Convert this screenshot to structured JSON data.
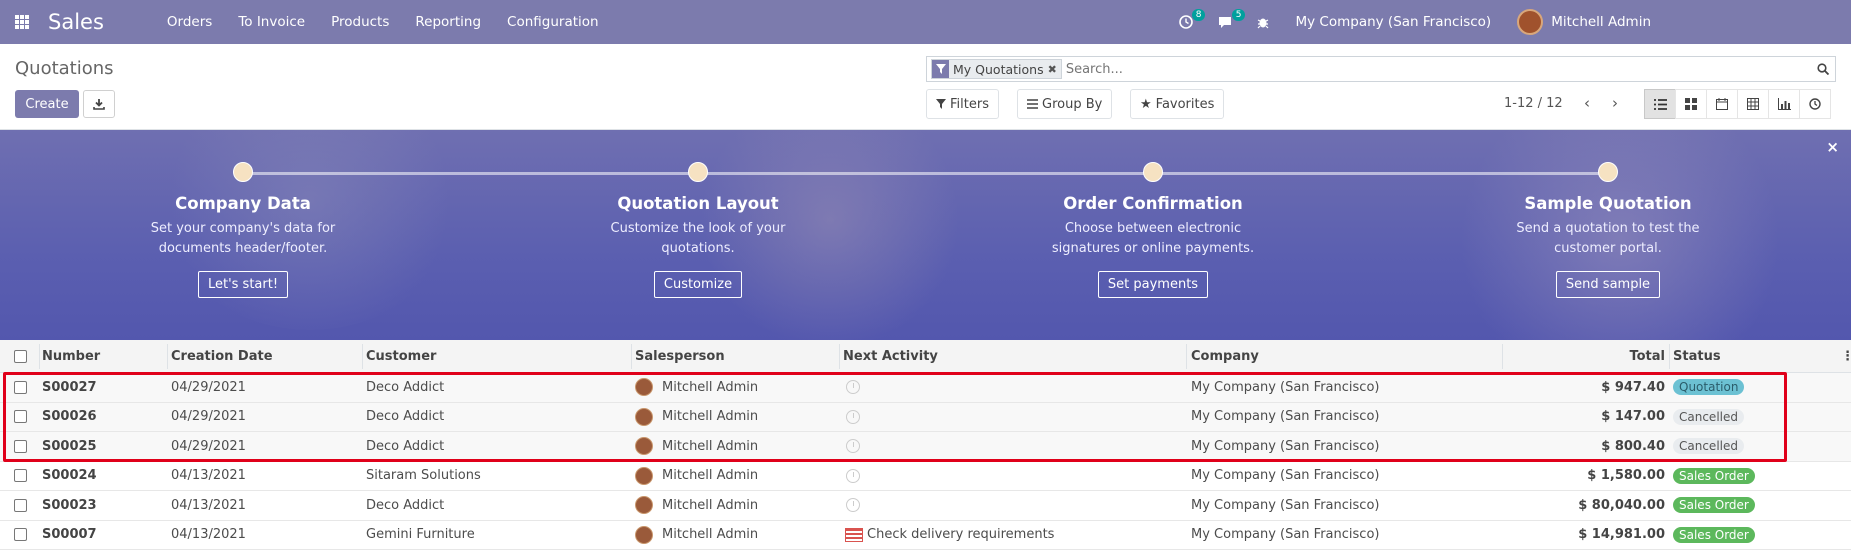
{
  "navbar": {
    "app_title": "Sales",
    "menu": [
      "Orders",
      "To Invoice",
      "Products",
      "Reporting",
      "Configuration"
    ],
    "activity_count": "8",
    "messages_count": "5",
    "company": "My Company (San Francisco)",
    "user": "Mitchell Admin"
  },
  "control_panel": {
    "breadcrumb": "Quotations",
    "create_label": "Create",
    "facet_label": "My Quotations",
    "search_placeholder": "Search...",
    "filters_label": "Filters",
    "groupby_label": "Group By",
    "favorites_label": "Favorites",
    "pager": "1-12 / 12"
  },
  "onboarding": {
    "steps": [
      {
        "title": "Company Data",
        "desc": "Set your company's data for documents header/footer.",
        "button": "Let's start!"
      },
      {
        "title": "Quotation Layout",
        "desc": "Customize the look of your quotations.",
        "button": "Customize"
      },
      {
        "title": "Order Confirmation",
        "desc": "Choose between electronic signatures or online payments.",
        "button": "Set payments"
      },
      {
        "title": "Sample Quotation",
        "desc": "Send a quotation to test the customer portal.",
        "button": "Send sample"
      }
    ],
    "close_icon": "×"
  },
  "table": {
    "headers": {
      "number": "Number",
      "creation_date": "Creation Date",
      "customer": "Customer",
      "salesperson": "Salesperson",
      "next_activity": "Next Activity",
      "company": "Company",
      "total": "Total",
      "status": "Status"
    },
    "rows": [
      {
        "number": "S00027",
        "date": "04/29/2021",
        "customer": "Deco Addict",
        "salesperson": "Mitchell Admin",
        "activity": "",
        "company": "My Company (San Francisco)",
        "total": "$ 947.40",
        "status": "Quotation"
      },
      {
        "number": "S00026",
        "date": "04/29/2021",
        "customer": "Deco Addict",
        "salesperson": "Mitchell Admin",
        "activity": "",
        "company": "My Company (San Francisco)",
        "total": "$ 147.00",
        "status": "Cancelled"
      },
      {
        "number": "S00025",
        "date": "04/29/2021",
        "customer": "Deco Addict",
        "salesperson": "Mitchell Admin",
        "activity": "",
        "company": "My Company (San Francisco)",
        "total": "$ 800.40",
        "status": "Cancelled"
      },
      {
        "number": "S00024",
        "date": "04/13/2021",
        "customer": "Sitaram Solutions",
        "salesperson": "Mitchell Admin",
        "activity": "",
        "company": "My Company (San Francisco)",
        "total": "$ 1,580.00",
        "status": "Sales Order"
      },
      {
        "number": "S00023",
        "date": "04/13/2021",
        "customer": "Deco Addict",
        "salesperson": "Mitchell Admin",
        "activity": "",
        "company": "My Company (San Francisco)",
        "total": "$ 80,040.00",
        "status": "Sales Order"
      },
      {
        "number": "S00007",
        "date": "04/13/2021",
        "customer": "Gemini Furniture",
        "salesperson": "Mitchell Admin",
        "activity": "Check delivery requirements",
        "company": "My Company (San Francisco)",
        "total": "$ 14,981.00",
        "status": "Sales Order"
      }
    ]
  },
  "colors": {
    "brand": "#7c7bad",
    "quotation_badge": "#6cc1d3",
    "cancelled_badge": "#e9ecef",
    "sales_order_badge": "#5cb85c",
    "highlight": "#e0001a"
  }
}
